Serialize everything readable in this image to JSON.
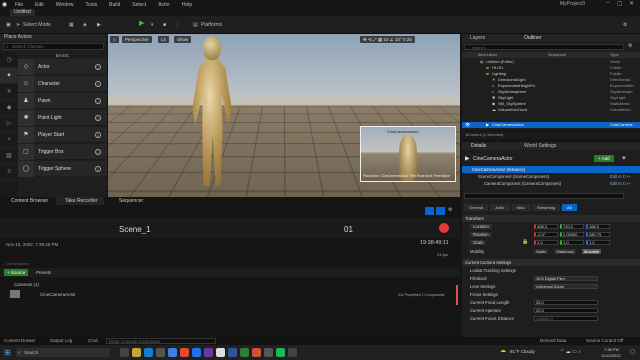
{
  "window": {
    "menu": [
      "File",
      "Edit",
      "Window",
      "Tools",
      "Build",
      "Select",
      "Actor",
      "Help"
    ],
    "project": "MyProject3",
    "level_tab": "Untitled"
  },
  "toolbar": {
    "select_mode": "Select Mode",
    "platforms": "Platforms"
  },
  "place_actors": {
    "tab": "Place Actors",
    "search_placeholder": "Search Classes",
    "group": "BASIC",
    "items": [
      "Actor",
      "Character",
      "Pawn",
      "Point Light",
      "Player Start",
      "Trigger Box",
      "Trigger Sphere"
    ]
  },
  "viewport": {
    "perspective": "Perspective",
    "lit": "Lit",
    "show": "Show",
    "pip_label": "CineCameraActor",
    "pip_caption": "Pilot Actor: CineCameraActor  Title Rust  Mod: Free4Spw"
  },
  "outliner": {
    "tabs": [
      "Layers",
      "Outliner"
    ],
    "search_placeholder": "Search",
    "col_label": "Item Label",
    "col_seq": "Sequence",
    "col_type": "Type",
    "rows": [
      {
        "label": "Untitled (Editor)",
        "type": "World"
      },
      {
        "label": "HLOD",
        "type": "Folder"
      },
      {
        "label": "Lighting",
        "type": "Folder"
      },
      {
        "label": "DirectionalLight",
        "type": "DirectionalL"
      },
      {
        "label": "ExponentialHeightFo",
        "type": "ExponentialH"
      },
      {
        "label": "SkyAtmosphere",
        "type": "SkyAtmosph"
      },
      {
        "label": "SkyLight",
        "type": "SkyLight"
      },
      {
        "label": "SM_SkySphere",
        "type": "StaticMesh"
      },
      {
        "label": "VolumetricCloud",
        "type": "VolumetricC"
      },
      {
        "label": "CineCameraActor",
        "type": "CineCamera"
      }
    ],
    "footer": "16 actors (1 selected)"
  },
  "details": {
    "tabs": [
      "Details",
      "World Settings"
    ],
    "actor": "CineCameraActor",
    "add": "+ Add",
    "instance": "CineCameraActor (Instance)",
    "scene_comp": "SceneComponent (SceneComponent)",
    "camera_comp": "CameraComponent (CameraComponent)",
    "edit_cpp": "Edit in C++",
    "filters": [
      "General",
      "Actor",
      "Misc",
      "Streaming",
      "All"
    ],
    "transform_header": "Transform",
    "location": {
      "label": "Location",
      "x": "498.0",
      "y": "720.0",
      "z": "166.0"
    },
    "rotation": {
      "label": "Rotation",
      "x": "-0.0°",
      "y": "2.00000",
      "z": "280.79"
    },
    "scale": {
      "label": "Scale",
      "x": "1.0",
      "y": "1.0",
      "z": "1.0"
    },
    "mobility": {
      "label": "Mobility",
      "options": [
        "Static",
        "Stationary",
        "Movable"
      ]
    },
    "current_camera": "Current Camera Settings",
    "lookat": "Lookat Tracking Settings",
    "filmback": {
      "label": "Filmback",
      "value": "16:9 Digital Film"
    },
    "lens": {
      "label": "Lens Settings",
      "value": "Universal Zoom"
    },
    "focus": "Focus Settings",
    "focal_length": {
      "label": "Current Focal Length",
      "value": "35.0"
    },
    "aperture": {
      "label": "Current Aperture",
      "value": "22.0"
    },
    "focus_distance": {
      "label": "Current Focus Distance",
      "value": "100000.0"
    }
  },
  "take_recorder": {
    "tabs": [
      "Content Browser",
      "Take Recorder",
      "Sequencer"
    ],
    "slate_label": "SLATE",
    "take_label": "TAKE",
    "scene": "Scene_1",
    "take": "01",
    "date": "Nov 10, 2022, 7:36:49 PM",
    "timecode": "19:38:49:11",
    "fps": "24 fps",
    "description": "<description>",
    "source_button": "+ Source",
    "presets": "Presets",
    "cameras_group": "Cameras (1)",
    "source_name": "CineCameraActor",
    "properties": "311 Properties 2 Components"
  },
  "status": {
    "items": [
      "Content Drawer",
      "Output Log",
      "Cmd"
    ],
    "console_placeholder": "Enter Console Command",
    "derived": "Derived Data",
    "source_control": "Source Control Off"
  },
  "taskbar": {
    "search": "Search",
    "weather": "81°F Cloudy",
    "time": "7:38 PM",
    "date": "11/10/2022"
  }
}
